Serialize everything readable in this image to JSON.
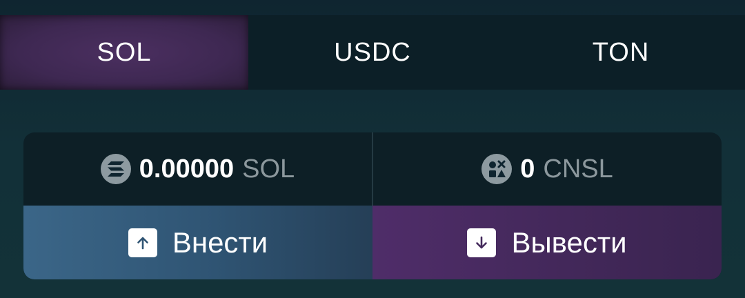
{
  "tabs": [
    {
      "label": "SOL",
      "active": true
    },
    {
      "label": "USDC",
      "active": false
    },
    {
      "label": "TON",
      "active": false
    }
  ],
  "balances": {
    "sol": {
      "amount": "0.00000",
      "unit": "SOL",
      "icon": "solana-icon"
    },
    "cnsl": {
      "amount": "0",
      "unit": "CNSL",
      "icon": "cnsl-token-icon"
    }
  },
  "actions": {
    "deposit_label": "Внести",
    "withdraw_label": "Вывести"
  },
  "colors": {
    "active_tab": "#3e2852",
    "deposit": "#2f5473",
    "withdraw": "#43285a",
    "muted_text": "#8c989d"
  }
}
